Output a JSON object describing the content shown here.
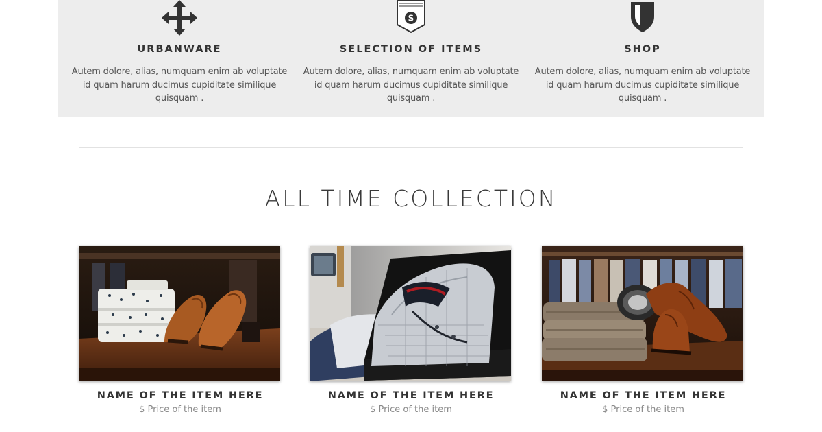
{
  "features": [
    {
      "icon": "move-arrows-icon",
      "title": "URBANWARE",
      "text": "Autem dolore, alias, numquam enim ab voluptate id quam harum ducimus cupiditate similique quisquam ."
    },
    {
      "icon": "badge-s-icon",
      "title": "SELECTION OF ITEMS",
      "text": "Autem dolore, alias, numquam enim ab voluptate id quam harum ducimus cupiditate similique quisquam ."
    },
    {
      "icon": "shield-icon",
      "title": "SHOP",
      "text": "Autem dolore, alias, numquam enim ab voluptate id quam harum ducimus cupiditate similique quisquam ."
    }
  ],
  "collection": {
    "title": "ALL TIME COLLECTION",
    "products": [
      {
        "name": "NAME OF THE ITEM HERE",
        "price": "$ Price of the item"
      },
      {
        "name": "NAME OF THE ITEM HERE",
        "price": "$ Price of the item"
      },
      {
        "name": "NAME OF THE ITEM HERE",
        "price": "$ Price of the item"
      }
    ]
  },
  "colors": {
    "panel": "#ededed",
    "text": "#333333",
    "muted": "#8a8a8a"
  }
}
